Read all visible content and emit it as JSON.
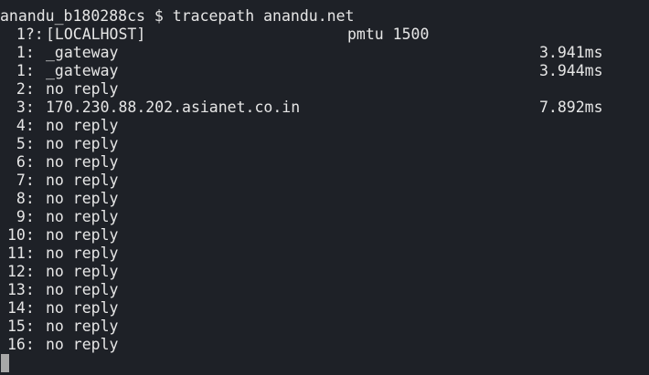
{
  "terminal": {
    "prompt_user": "anandu_b180288cs",
    "prompt_symbol": "$",
    "command": "tracepath anandu.net",
    "hops": [
      {
        "num": " 1?:",
        "host": "[LOCALHOST]",
        "pmtu": "pmtu 1500",
        "time": ""
      },
      {
        "num": " 1:",
        "host": "_gateway",
        "pmtu": "",
        "time": "3.941ms"
      },
      {
        "num": " 1:",
        "host": "_gateway",
        "pmtu": "",
        "time": "3.944ms"
      },
      {
        "num": " 2:",
        "host": "no reply",
        "pmtu": "",
        "time": ""
      },
      {
        "num": " 3:",
        "host": "170.230.88.202.asianet.co.in",
        "pmtu": "",
        "time": "7.892ms"
      },
      {
        "num": " 4:",
        "host": "no reply",
        "pmtu": "",
        "time": ""
      },
      {
        "num": " 5:",
        "host": "no reply",
        "pmtu": "",
        "time": ""
      },
      {
        "num": " 6:",
        "host": "no reply",
        "pmtu": "",
        "time": ""
      },
      {
        "num": " 7:",
        "host": "no reply",
        "pmtu": "",
        "time": ""
      },
      {
        "num": " 8:",
        "host": "no reply",
        "pmtu": "",
        "time": ""
      },
      {
        "num": " 9:",
        "host": "no reply",
        "pmtu": "",
        "time": ""
      },
      {
        "num": "10:",
        "host": "no reply",
        "pmtu": "",
        "time": ""
      },
      {
        "num": "11:",
        "host": "no reply",
        "pmtu": "",
        "time": ""
      },
      {
        "num": "12:",
        "host": "no reply",
        "pmtu": "",
        "time": ""
      },
      {
        "num": "13:",
        "host": "no reply",
        "pmtu": "",
        "time": ""
      },
      {
        "num": "14:",
        "host": "no reply",
        "pmtu": "",
        "time": ""
      },
      {
        "num": "15:",
        "host": "no reply",
        "pmtu": "",
        "time": ""
      },
      {
        "num": "16:",
        "host": "no reply",
        "pmtu": "",
        "time": ""
      }
    ]
  },
  "colors": {
    "background": "#1e2127",
    "foreground": "#e6e6e6",
    "cursor": "#a8a8a8"
  }
}
